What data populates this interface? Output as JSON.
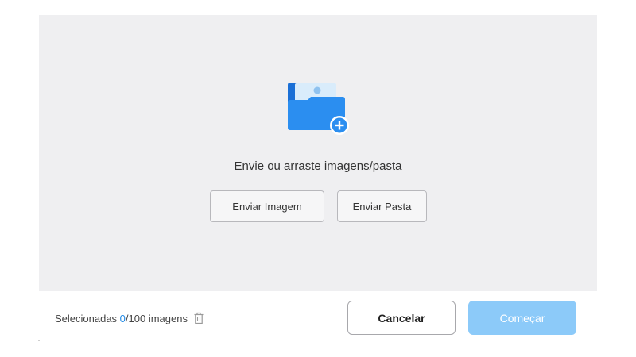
{
  "drop_zone": {
    "icon": "folder-add-image-icon",
    "instruction": "Envie ou arraste imagens/pasta",
    "upload_image_label": "Enviar Imagem",
    "upload_folder_label": "Enviar Pasta"
  },
  "footer": {
    "selected_prefix": "Selecionadas ",
    "selected_count": "0",
    "selected_suffix": "/100 imagens",
    "trash_icon": "trash-icon",
    "cancel_label": "Cancelar",
    "start_label": "Começar"
  },
  "colors": {
    "accent": "#1e88e5",
    "start_button_disabled": "#8ccaf9",
    "drop_zone_bg": "#efeff1"
  }
}
